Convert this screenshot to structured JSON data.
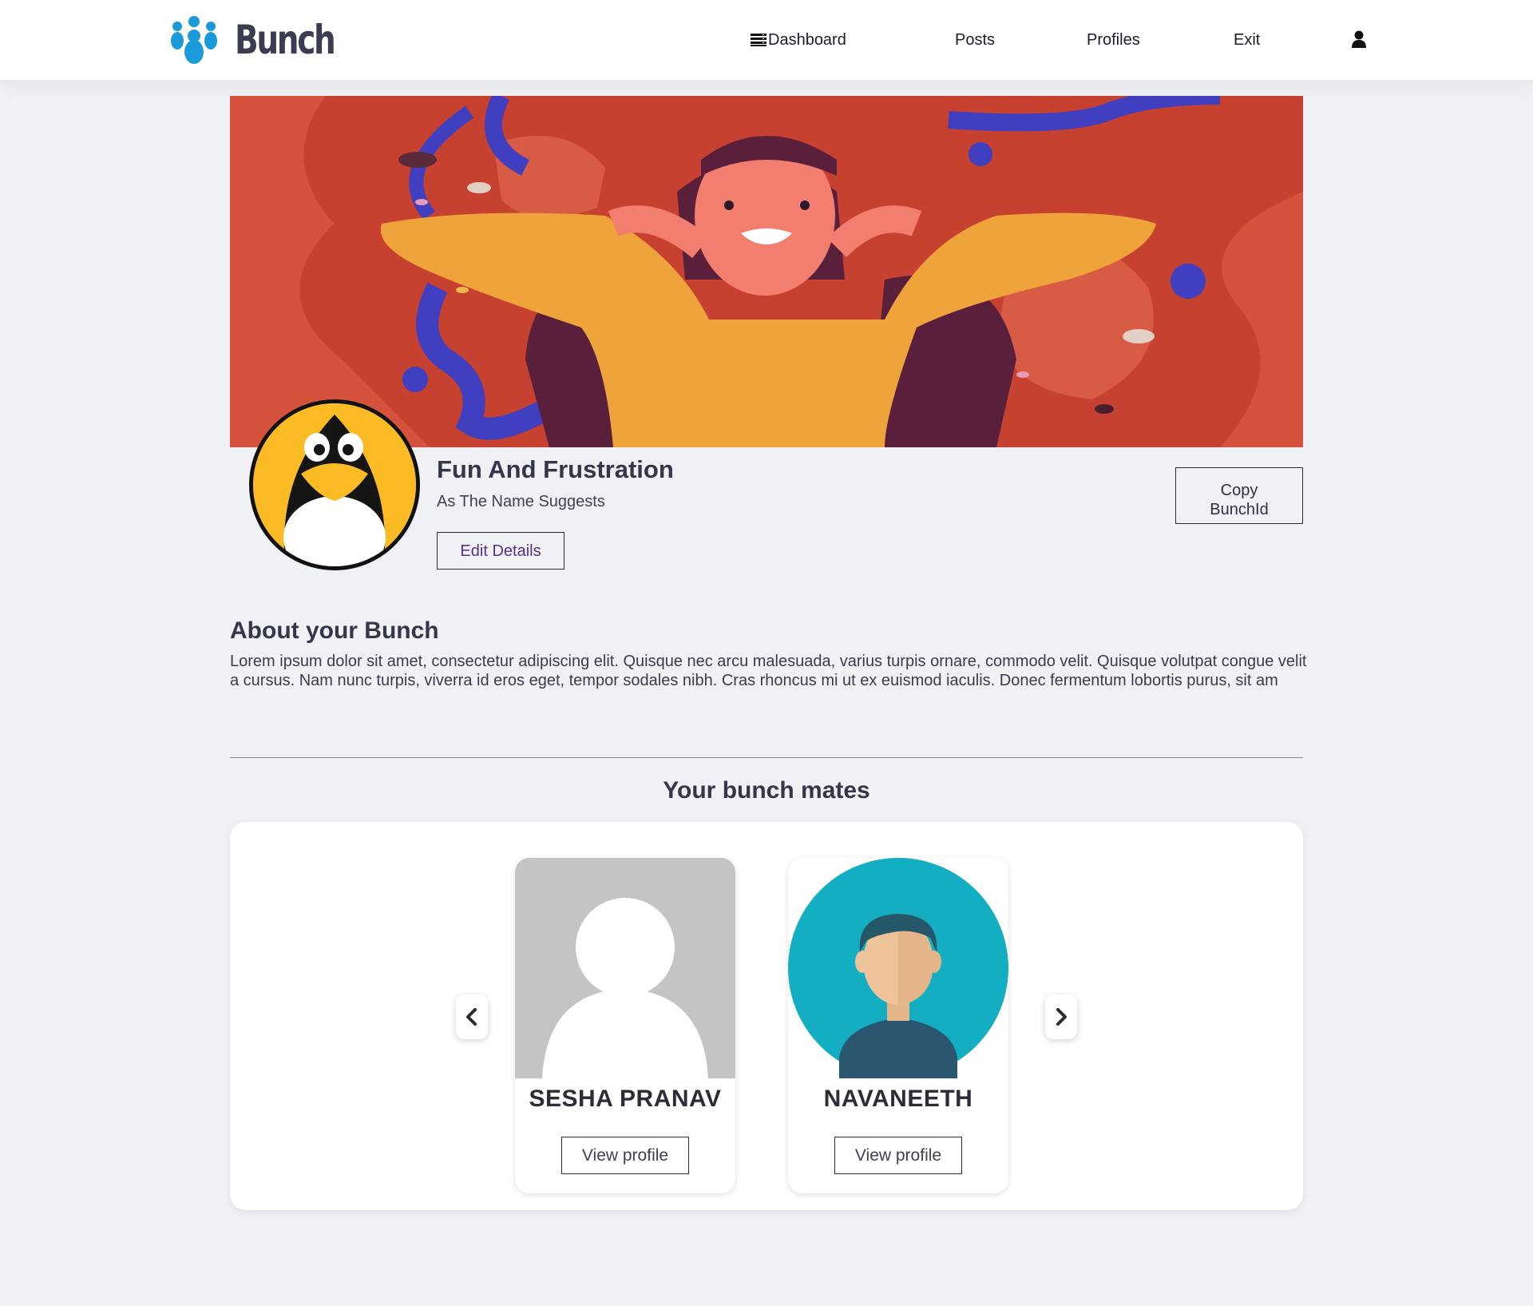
{
  "app": {
    "brand": "Bunch",
    "brand_color": "#1a9ad9"
  },
  "nav": {
    "dashboard": "Dashboard",
    "posts": "Posts",
    "profiles": "Profiles",
    "exit": "Exit",
    "user_icon": "user-icon",
    "dashboard_icon": "menu-icon"
  },
  "bunch": {
    "title": "Fun And Frustration",
    "subtitle": "As The Name Suggests",
    "edit_label": "Edit Details",
    "copy_label_line1": "Copy",
    "copy_label_line2": "BunchId",
    "avatar_icon": "penguin-icon"
  },
  "about": {
    "title": "About your Bunch",
    "text": "Lorem ipsum dolor sit amet, consectetur adipiscing elit. Quisque nec arcu malesuada, varius turpis ornare, commodo velit. Quisque volutpat congue velit a cursus. Nam nunc turpis, viverra id eros eget, tempor sodales nibh. Cras rhoncus mi ut ex euismod iaculis. Donec fermentum lobortis purus, sit am"
  },
  "mates": {
    "title": "Your bunch mates",
    "prev_icon": "chevron-left-icon",
    "next_icon": "chevron-right-icon",
    "items": [
      {
        "name": "SESHA PRANAV",
        "button": "View profile",
        "photo": "default-avatar"
      },
      {
        "name": "NAVANEETH",
        "button": "View profile",
        "photo": "man-avatar"
      }
    ]
  },
  "colors": {
    "page_bg": "#f0f1f5",
    "banner_bg": "#c9412f",
    "penguin_bg": "#fbbb24",
    "avatar_teal": "#13aec1"
  }
}
